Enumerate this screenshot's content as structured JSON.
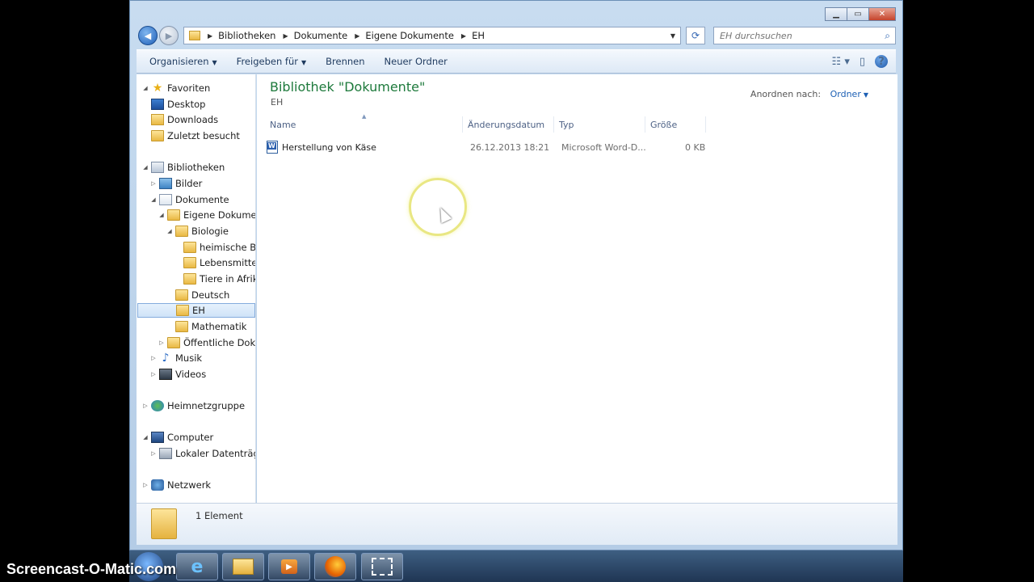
{
  "window": {
    "caption": {
      "minimize": "▁",
      "maximize": "▭",
      "close": "✕"
    }
  },
  "address_bar": {
    "crumbs": [
      "Bibliotheken",
      "Dokumente",
      "Eigene Dokumente",
      "EH"
    ],
    "search_placeholder": "EH durchsuchen"
  },
  "command_bar": {
    "organize": "Organisieren",
    "share": "Freigeben für",
    "burn": "Brennen",
    "new_folder": "Neuer Ordner"
  },
  "nav_pane": {
    "items": [
      {
        "label": "Favoriten",
        "icon": "star-icon"
      },
      {
        "label": "Desktop",
        "icon": "desktop-icon"
      },
      {
        "label": "Downloads",
        "icon": "downloads-icon"
      },
      {
        "label": "Zuletzt besucht",
        "icon": "recent-places-icon"
      },
      {
        "label": "Bibliotheken",
        "icon": "libraries-icon"
      },
      {
        "label": "Bilder",
        "icon": "pictures-icon"
      },
      {
        "label": "Dokumente",
        "icon": "documents-icon"
      },
      {
        "label": "Eigene Dokumente",
        "icon": "folder-icon"
      },
      {
        "label": "Biologie",
        "icon": "folder-icon"
      },
      {
        "label": "heimische Bäume",
        "icon": "folder-icon"
      },
      {
        "label": "Lebensmittel",
        "icon": "folder-icon"
      },
      {
        "label": "Tiere in Afrika",
        "icon": "folder-icon"
      },
      {
        "label": "Deutsch",
        "icon": "folder-icon"
      },
      {
        "label": "EH",
        "icon": "folder-icon"
      },
      {
        "label": "Mathematik",
        "icon": "folder-icon"
      },
      {
        "label": "Öffentliche Dokumente",
        "icon": "folder-icon"
      },
      {
        "label": "Musik",
        "icon": "music-icon"
      },
      {
        "label": "Videos",
        "icon": "videos-icon"
      },
      {
        "label": "Heimnetzgruppe",
        "icon": "homegroup-icon"
      },
      {
        "label": "Computer",
        "icon": "computer-icon"
      },
      {
        "label": "Lokaler Datenträger",
        "icon": "local-disk-icon"
      },
      {
        "label": "Netzwerk",
        "icon": "network-icon"
      }
    ],
    "selected": "EH"
  },
  "content": {
    "library_title": "Bibliothek \"Dokumente\"",
    "library_subtitle": "EH",
    "arrange_label": "Anordnen nach:",
    "arrange_value": "Ordner",
    "columns": [
      "Name",
      "Änderungsdatum",
      "Typ",
      "Größe"
    ],
    "files": [
      {
        "name": "Herstellung von Käse",
        "date": "26.12.2013 18:21",
        "type": "Microsoft Word-D...",
        "size": "0 KB",
        "icon": "word-document-icon"
      }
    ]
  },
  "details_pane": {
    "count": "1 Element"
  },
  "taskbar": {
    "items": [
      "internet-explorer-icon",
      "windows-explorer-icon",
      "media-player-icon",
      "firefox-icon",
      "snipping-tool-icon"
    ]
  },
  "watermark": "Screencast-O-Matic.com"
}
